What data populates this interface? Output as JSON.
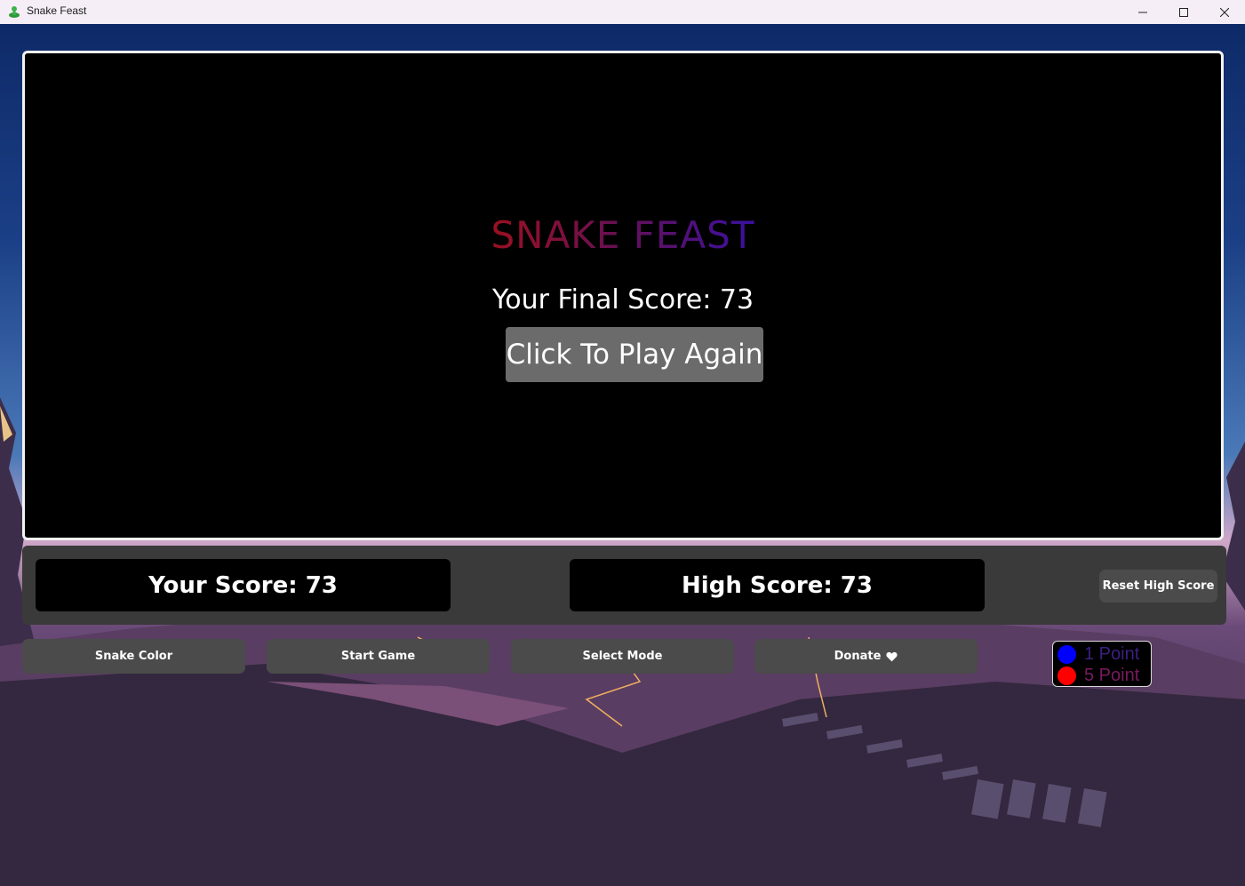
{
  "window": {
    "title": "Snake Feast",
    "minimize_glyph": "─",
    "maximize_glyph": "☐",
    "close_glyph": "✕"
  },
  "game": {
    "title": "SNAKE FEAST",
    "final_score_text": "Your Final Score: 73",
    "play_again_label": "Click To Play Again"
  },
  "scores": {
    "your_score_text": "Your Score: 73",
    "high_score_text": "High Score: 73",
    "reset_label": "Reset High Score"
  },
  "controls": {
    "snake_color_label": "Snake Color",
    "start_game_label": "Start Game",
    "select_mode_label": "Select Mode",
    "donate_label": "Donate",
    "donate_icon": "heart-icon"
  },
  "legend": {
    "items": [
      {
        "label": "1 Point",
        "color": "#0000ff"
      },
      {
        "label": "5 Point",
        "color": "#ff0000"
      }
    ]
  },
  "colors": {
    "canvas_bg": "#000000",
    "button_bg": "#4b4b4b",
    "play_again_bg": "#6b6b6b",
    "sky_top": "#0d2a66",
    "ground": "#2e2740"
  }
}
